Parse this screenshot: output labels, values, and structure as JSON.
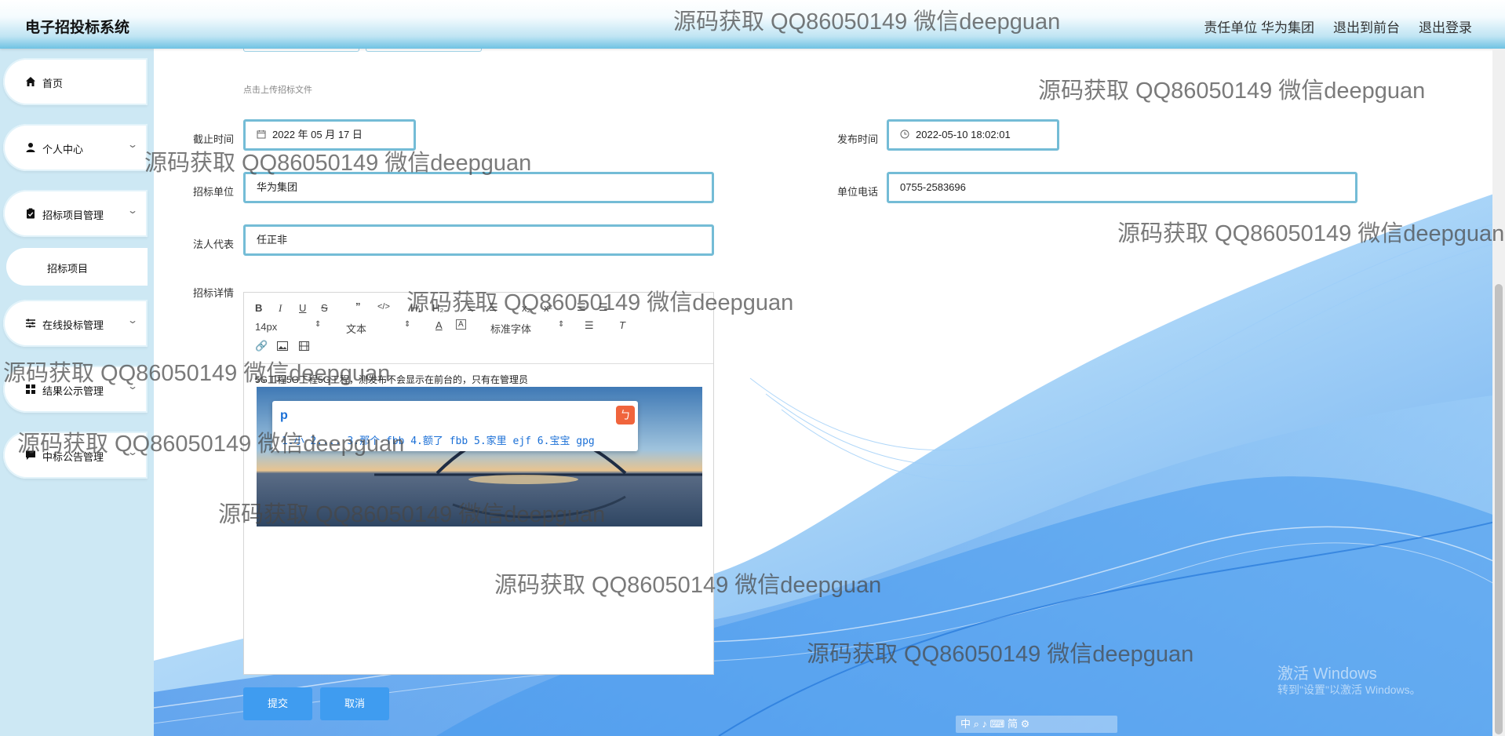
{
  "header": {
    "title": "电子招投标系统",
    "nav": [
      "责任单位 华为集团",
      "退出到前台",
      "退出登录"
    ]
  },
  "sidebar": {
    "items": [
      {
        "label": "首页",
        "icon": "home-icon"
      },
      {
        "label": "个人中心",
        "icon": "user-icon"
      },
      {
        "label": "招标项目管理",
        "icon": "clipboard-icon"
      },
      {
        "label": "在线投标管理",
        "icon": "sliders-icon"
      },
      {
        "label": "结果公示管理",
        "icon": "grid-icon"
      },
      {
        "label": "中标公告管理",
        "icon": "message-icon"
      }
    ],
    "sub_item": "招标项目"
  },
  "form": {
    "upload_hint": "点击上传招标文件",
    "deadline_label": "截止时间",
    "deadline_value": "2022 年 05 月 17 日",
    "publish_label": "发布时间",
    "publish_value": "2022-05-10 18:02:01",
    "unit_label": "招标单位",
    "unit_value": "华为集团",
    "phone_label": "单位电话",
    "phone_value": "0755-2583696",
    "legal_label": "法人代表",
    "legal_value": "任正非",
    "detail_label": "招标详情"
  },
  "editor": {
    "font_size": "14px",
    "text_style": "文本",
    "font_family": "标准字体",
    "content": "5G工程5G工程5G工程，测发布不会显示在前台的，只有在管理员",
    "ime": {
      "composition": "p",
      "candidates": "1.小 2.... 3.那个 fbb 4.额了 fbb 5.家里 ejf 6.宝宝 gpg"
    }
  },
  "buttons": {
    "submit": "提交",
    "cancel": "取消"
  },
  "watermark": "源码获取 QQ86050149 微信deepguan",
  "windows": {
    "activate_title": "激活 Windows",
    "activate_hint": "转到\"设置\"以激活 Windows。"
  },
  "colors": {
    "accent": "#3f9cf0",
    "input_border": "#74bcd6",
    "sidebar_bg": "#cde8f4"
  }
}
